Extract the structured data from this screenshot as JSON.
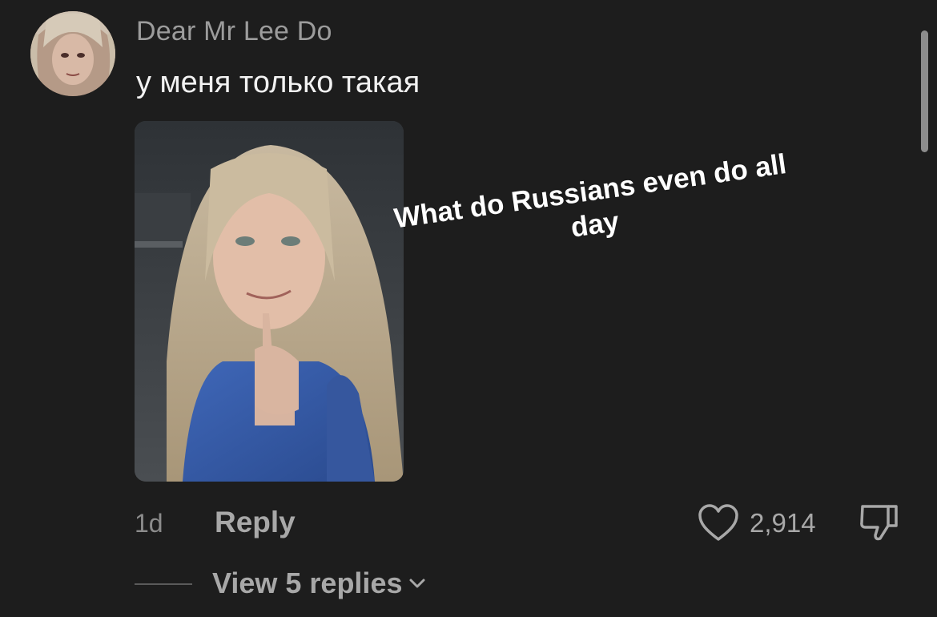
{
  "comment": {
    "username": "Dear Mr Lee Do",
    "text": "у меня только такая",
    "image_caption": "What do Russians even do all day",
    "timestamp": "1d",
    "reply_label": "Reply",
    "like_count": "2,914",
    "view_replies_label": "View 5 replies"
  },
  "icons": {
    "avatar": "avatar",
    "like": "heart-icon",
    "dislike": "thumbs-down-icon",
    "chevron": "chevron-down-icon"
  },
  "colors": {
    "background": "#1d1d1d",
    "username": "#9c9c9c",
    "text": "#f2f2f2",
    "muted": "#a8a8a8"
  }
}
